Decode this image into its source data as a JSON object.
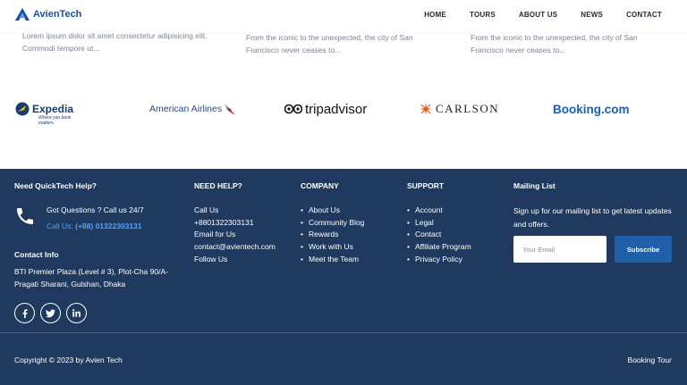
{
  "header": {
    "logo_text": "AvienTech",
    "nav": [
      "HOME",
      "TOURS",
      "ABOUT US",
      "NEWS",
      "CONTACT"
    ]
  },
  "cards": [
    {
      "text": "Lorem ipsum dolor sit amet consectetur adipisicing elit. Commodi tempore ut..."
    },
    {
      "text": "From the iconic to the unexpected, the city of San Francisco never ceases to..."
    },
    {
      "text": "From the iconic to the unexpected, the city of San Francisco never ceases to..."
    }
  ],
  "partners": {
    "expedia": "Expedia",
    "expedia_tagline": "Where you book matters.",
    "american_airlines": "American Airlines",
    "tripadvisor": "tripadvisor",
    "carlson": "CARLSON",
    "booking": "Booking.com"
  },
  "footer": {
    "help": {
      "heading": "Need QuickTech Help?",
      "got_questions": "Got Questions ? Call us 24/7",
      "call_prefix": "Call Us: ",
      "call_number": "(+88) 01322303131",
      "contact_heading": "Contact Info",
      "address": "BTI Premier Plaza (Level # 3), Plot-Cha 90/A- Pragati Sharani, Gulshan, Dhaka"
    },
    "need_help": {
      "heading": "NEED HELP?",
      "items": [
        "Call Us",
        "+8801322303131",
        "Email for Us",
        "contact@avientech.com",
        "Follow Us"
      ]
    },
    "company": {
      "heading": "COMPANY",
      "items": [
        "About Us",
        "Community Blog",
        "Rewards",
        "Work with Us",
        "Meet the Team"
      ]
    },
    "support": {
      "heading": "SUPPORT",
      "items": [
        "Account",
        "Legal",
        "Contact",
        "Affiliate Program",
        "Privacy Policy"
      ]
    },
    "mailing": {
      "heading": "Mailing List",
      "description": "Sign up for our mailing list to get latest updates and offers.",
      "placeholder": "Your Email",
      "button": "Subscribe"
    },
    "socials": [
      "facebook-icon",
      "twitter-icon",
      "linkedin-icon"
    ],
    "copyright": "Copyright © 2023 by Avien Tech",
    "booking_tour": "Booking Tour"
  },
  "colors": {
    "footer_bg": "#1f3a5e",
    "accent_blue": "#4fa3ff",
    "button_blue": "#2060aa"
  }
}
